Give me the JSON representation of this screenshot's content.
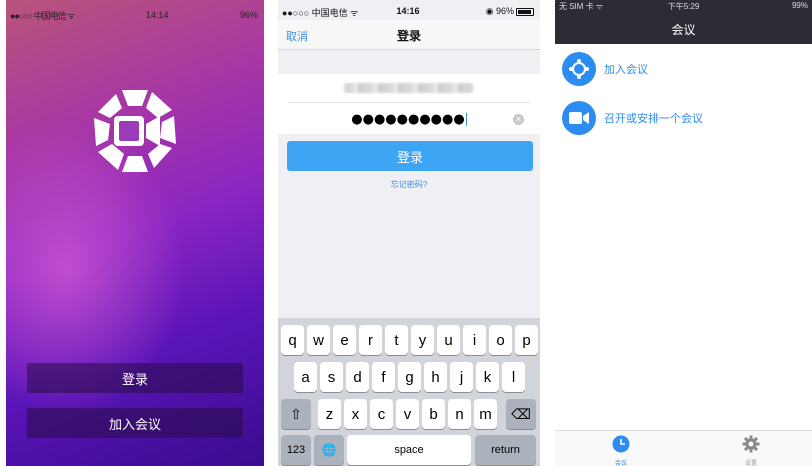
{
  "screen1": {
    "status": {
      "carrier": "●●○○○ 中国电信 ᯤ",
      "time": "14:14",
      "battery": "96%"
    },
    "login_label": "登录",
    "join_label": "加入会议"
  },
  "screen2": {
    "status": {
      "carrier": "●●○○○ 中国电信 ᯤ",
      "time": "14:16",
      "battery": "◉ 96%"
    },
    "nav": {
      "cancel": "取消",
      "title": "登录"
    },
    "password_value": "●●●●●●●●●●",
    "login_button": "登录",
    "forgot_link": "忘记密码?",
    "keyboard": {
      "row1": [
        "q",
        "w",
        "e",
        "r",
        "t",
        "y",
        "u",
        "i",
        "o",
        "p"
      ],
      "row2": [
        "a",
        "s",
        "d",
        "f",
        "g",
        "h",
        "j",
        "k",
        "l"
      ],
      "row3": [
        "z",
        "x",
        "c",
        "v",
        "b",
        "n",
        "m"
      ],
      "shift_icon": "⇧",
      "delete_icon": "⌫",
      "num_key": "123",
      "globe_icon": "🌐",
      "space": "space",
      "return": "return"
    }
  },
  "screen3": {
    "status": {
      "carrier": "无 SIM 卡 ᯤ",
      "time": "下午5:29",
      "battery": "99%"
    },
    "title": "会议",
    "items": [
      {
        "label": "加入会议",
        "icon": "join-meeting-icon"
      },
      {
        "label": "召开或安排一个会议",
        "icon": "video-camera-icon"
      }
    ],
    "tabs": [
      {
        "label": "会议",
        "icon": "clock-icon",
        "active": true
      },
      {
        "label": "设置",
        "icon": "gear-icon",
        "active": false
      }
    ]
  },
  "colors": {
    "accent": "#2d8cf0",
    "login_button": "#3ea5f5",
    "topbar_dark": "#2c2c34"
  }
}
